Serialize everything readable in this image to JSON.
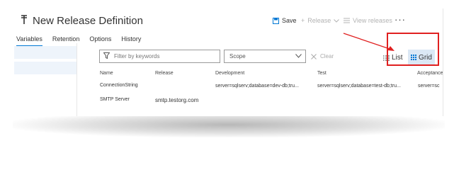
{
  "header": {
    "title": "New Release Definition",
    "save_label": "Save",
    "release_label": "Release",
    "view_releases_label": "View releases",
    "more_label": "···"
  },
  "tabs": [
    {
      "label": "Variables",
      "active": true
    },
    {
      "label": "Retention"
    },
    {
      "label": "Options"
    },
    {
      "label": "History"
    }
  ],
  "toolbar": {
    "filter_placeholder": "Filter by keywords",
    "scope_value": "Scope",
    "clear_label": "Clear",
    "list_label": "List",
    "grid_label": "Grid"
  },
  "table": {
    "columns": [
      "Name",
      "Release",
      "Development",
      "Test",
      "Acceptance"
    ],
    "rows": [
      {
        "name": "ConnectionString",
        "release": "",
        "development": "server=sqlserv;database=dev-db;tru...",
        "test": "server=sqlserv;database=test-db;tru...",
        "acceptance": "server=sc"
      },
      {
        "name": "SMTP Server",
        "release": "smtp.testorg.com",
        "development": "",
        "test": "",
        "acceptance": ""
      }
    ]
  },
  "colors": {
    "accent": "#0078d4",
    "highlight": "#e02020",
    "selected_bg": "#dbe8f5"
  }
}
